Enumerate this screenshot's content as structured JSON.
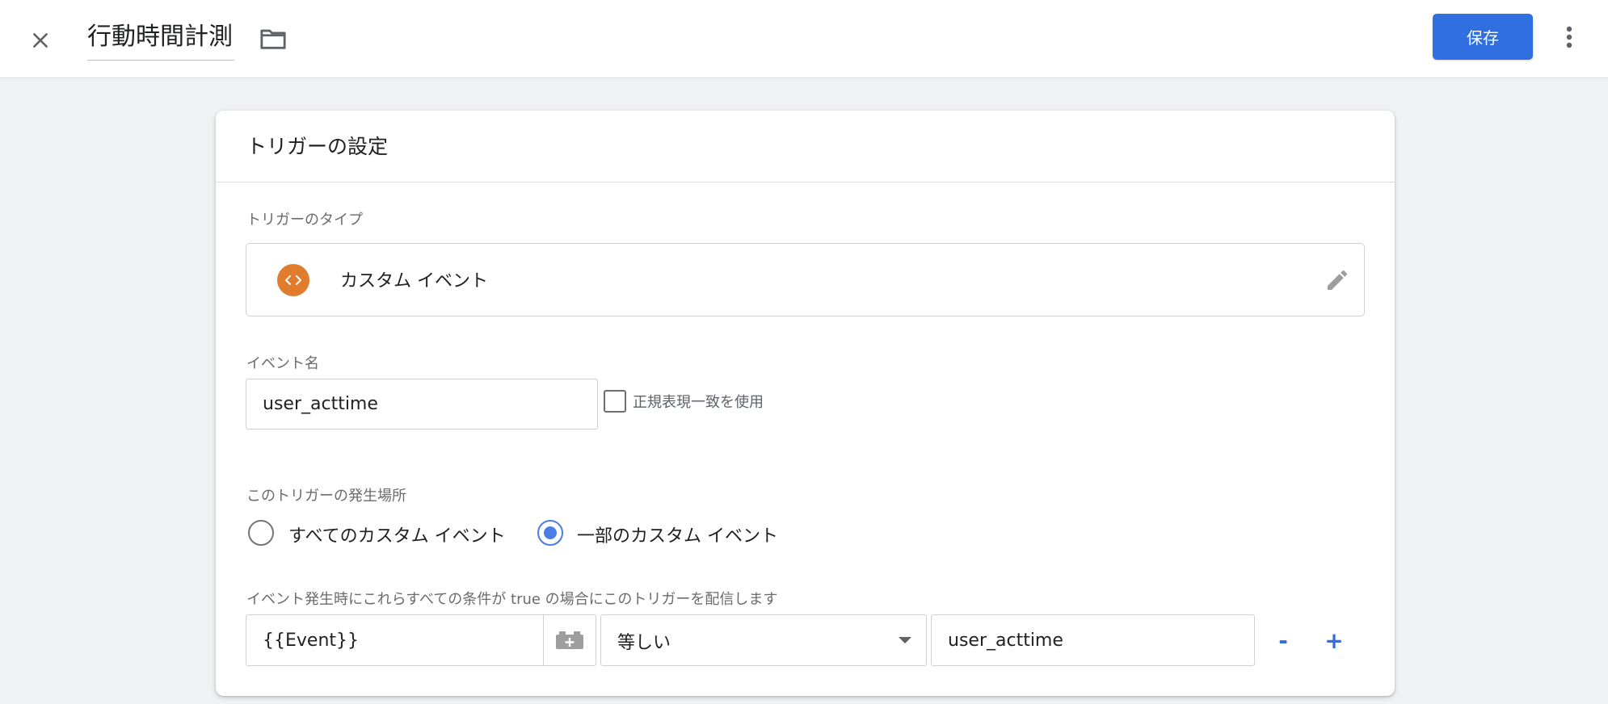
{
  "header": {
    "title": "行動時間計測",
    "save_label": "保存"
  },
  "card": {
    "title": "トリガーの設定",
    "trigger_type_label": "トリガーのタイプ",
    "trigger_type_name": "カスタム イベント",
    "event_name_label": "イベント名",
    "event_name_value": "user_acttime",
    "regex_label": "正規表現一致を使用",
    "fire_on_label": "このトリガーの発生場所",
    "radio_all_label": "すべてのカスタム イベント",
    "radio_some_label": "一部のカスタム イベント",
    "condition_label": "イベント発生時にこれらすべての条件が true の場合にこのトリガーを配信します",
    "condition": {
      "variable": "{{Event}}",
      "operator": "等しい",
      "value": "user_acttime"
    },
    "remove_row_label": "-",
    "add_row_label": "+"
  },
  "colors": {
    "accent": "#2f6fe0",
    "trigger_icon": "#e17b2e",
    "radio_selected": "#4a7ee6"
  },
  "icons": [
    "close-icon",
    "folder-icon",
    "more-vert-icon",
    "custom-event-icon",
    "pencil-icon",
    "variable-add-icon",
    "chevron-down-icon"
  ]
}
